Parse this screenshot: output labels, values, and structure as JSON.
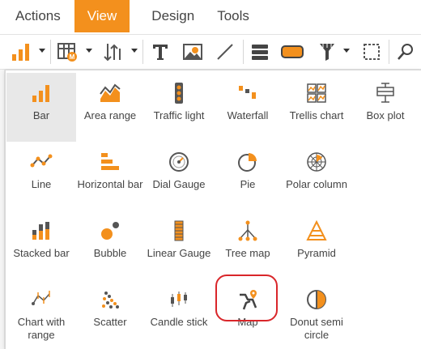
{
  "menu": {
    "tabs": [
      "Actions",
      "View",
      "Design",
      "Tools"
    ],
    "active": "View"
  },
  "toolbar": {
    "icons": [
      "bar-chart-icon",
      "table-icon",
      "sort-icon",
      "text-icon",
      "image-icon",
      "line-icon",
      "rows-icon",
      "rounded-box-icon",
      "filter-icon",
      "select-area-icon",
      "search-icon"
    ]
  },
  "colors": {
    "accent": "#f3901d",
    "highlight": "#d9262a",
    "icon_dark": "#555555"
  },
  "chart_types": [
    {
      "label": "Bar",
      "icon": "bar-icon",
      "selected": true
    },
    {
      "label": "Area range",
      "icon": "area-range-icon"
    },
    {
      "label": "Traffic light",
      "icon": "traffic-light-icon"
    },
    {
      "label": "Waterfall",
      "icon": "waterfall-icon"
    },
    {
      "label": "Trellis chart",
      "icon": "trellis-chart-icon"
    },
    {
      "label": "Box plot",
      "icon": "box-plot-icon"
    },
    {
      "label": "Line",
      "icon": "line-icon"
    },
    {
      "label": "Horizontal bar",
      "icon": "horizontal-bar-icon"
    },
    {
      "label": "Dial Gauge",
      "icon": "dial-gauge-icon"
    },
    {
      "label": "Pie",
      "icon": "pie-icon"
    },
    {
      "label": "Polar column",
      "icon": "polar-column-icon"
    },
    {
      "label": "Stacked bar",
      "icon": "stacked-bar-icon"
    },
    {
      "label": "Bubble",
      "icon": "bubble-icon"
    },
    {
      "label": "Linear Gauge",
      "icon": "linear-gauge-icon"
    },
    {
      "label": "Tree map",
      "icon": "tree-map-icon"
    },
    {
      "label": "Pyramid",
      "icon": "pyramid-icon"
    },
    {
      "label": "Chart with range",
      "icon": "chart-with-range-icon"
    },
    {
      "label": "Scatter",
      "icon": "scatter-icon"
    },
    {
      "label": "Candle stick",
      "icon": "candle-stick-icon"
    },
    {
      "label": "Map",
      "icon": "map-icon",
      "highlighted": true
    },
    {
      "label": "Donut semi circle",
      "icon": "donut-semi-circle-icon"
    }
  ]
}
